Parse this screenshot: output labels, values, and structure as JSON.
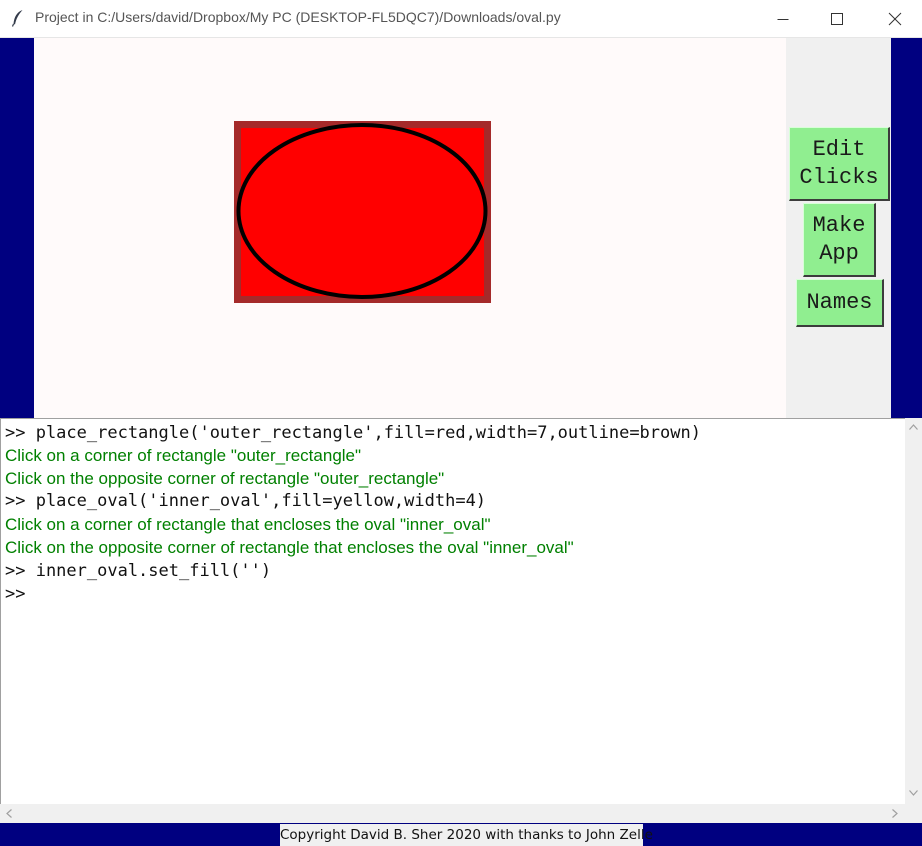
{
  "window": {
    "title": "Project in C:/Users/david/Dropbox/My PC (DESKTOP-FL5DQC7)/Downloads/oval.py",
    "icon": "feather-icon",
    "controls": [
      "minimize-icon",
      "maximize-icon",
      "close-icon"
    ]
  },
  "colors": {
    "frame": "#000080",
    "canvas_bg": "#fffafa",
    "button_bg": "#90ee90",
    "console_message": "#008000",
    "rect_fill": "#ff0000",
    "rect_outline": "#a52a2a",
    "oval_fill": "#ff0000",
    "oval_outline": "#000000"
  },
  "buttons": {
    "edit_clicks": [
      "Edit",
      "Clicks"
    ],
    "make_app": [
      "Make",
      "App"
    ],
    "names": "Names"
  },
  "console": {
    "lines": [
      {
        "type": "command",
        "text": ">> place_rectangle('outer_rectangle',fill=red,width=7,outline=brown)"
      },
      {
        "type": "message",
        "text": "Click on a corner of rectangle \"outer_rectangle\""
      },
      {
        "type": "message",
        "text": "Click on the opposite corner of rectangle \"outer_rectangle\""
      },
      {
        "type": "command",
        "text": ">> place_oval('inner_oval',fill=yellow,width=4)"
      },
      {
        "type": "message",
        "text": "Click on a corner of rectangle that encloses the oval \"inner_oval\""
      },
      {
        "type": "message",
        "text": "Click on the opposite corner of rectangle that encloses the oval \"inner_oval\""
      },
      {
        "type": "command",
        "text": ">> inner_oval.set_fill('')"
      },
      {
        "type": "prompt",
        "text": ">>"
      }
    ]
  },
  "footer": {
    "copyright": "Copyright David B. Sher 2020 with thanks to John Zelle"
  }
}
